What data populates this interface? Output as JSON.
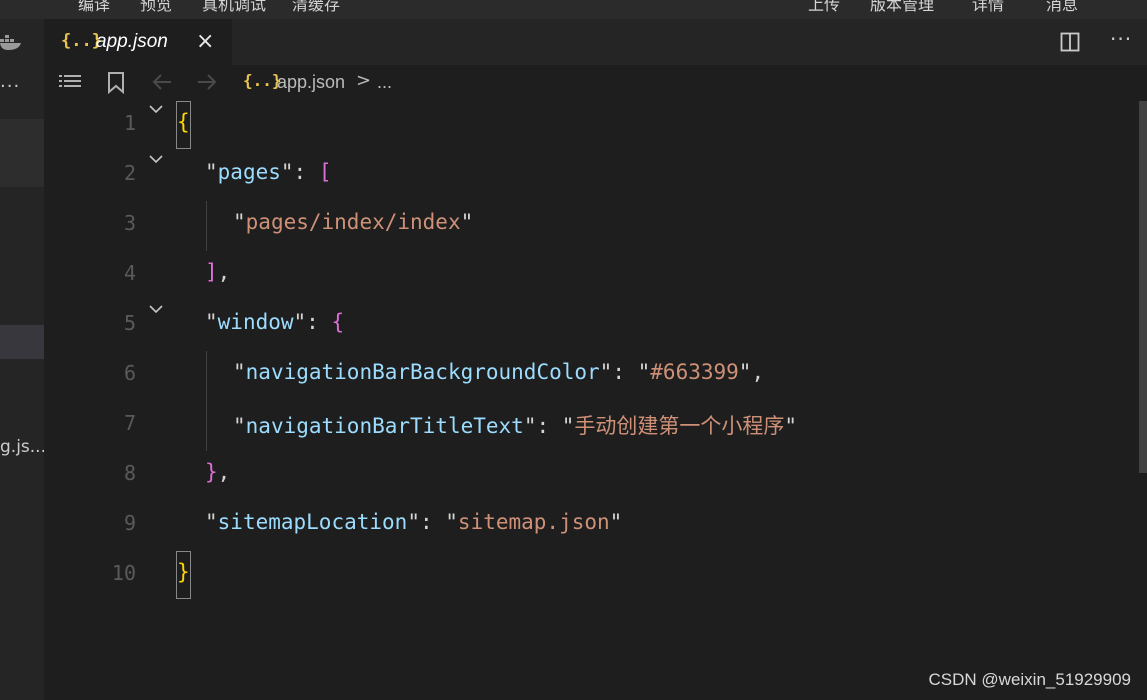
{
  "menubar": {
    "left_items": [
      "编译",
      "预览",
      "真机调试",
      "清缓存"
    ],
    "right_items": [
      "上传",
      "版本管理",
      "详情",
      "消息"
    ]
  },
  "sidebar": {
    "overflow_label": "...",
    "file_fragment": "g.js..."
  },
  "tab": {
    "icon_text": "{..}",
    "label": "app.json",
    "close_glyph": "×"
  },
  "toolbar": {
    "more_label": "···"
  },
  "breadcrumb": {
    "icon_text": "{..}",
    "file": "app.json",
    "separator": ">",
    "ellipsis": "..."
  },
  "editor": {
    "line_numbers": [
      "1",
      "2",
      "3",
      "4",
      "5",
      "6",
      "7",
      "8",
      "9",
      "10"
    ],
    "lines": [
      {
        "tokens": [
          {
            "t": "{",
            "c": "b1"
          }
        ]
      },
      {
        "tokens": [
          {
            "t": "\"",
            "c": "q"
          },
          {
            "t": "pages",
            "c": "k"
          },
          {
            "t": "\"",
            "c": "q"
          },
          {
            "t": ": ",
            "c": "p"
          },
          {
            "t": "[",
            "c": "b2"
          }
        ]
      },
      {
        "tokens": [
          {
            "t": "\"",
            "c": "q"
          },
          {
            "t": "pages/index/index",
            "c": "s"
          },
          {
            "t": "\"",
            "c": "q"
          }
        ]
      },
      {
        "tokens": [
          {
            "t": "]",
            "c": "b2"
          },
          {
            "t": ",",
            "c": "p"
          }
        ]
      },
      {
        "tokens": [
          {
            "t": "\"",
            "c": "q"
          },
          {
            "t": "window",
            "c": "k"
          },
          {
            "t": "\"",
            "c": "q"
          },
          {
            "t": ": ",
            "c": "p"
          },
          {
            "t": "{",
            "c": "b2"
          }
        ]
      },
      {
        "tokens": [
          {
            "t": "\"",
            "c": "q"
          },
          {
            "t": "navigationBarBackgroundColor",
            "c": "k"
          },
          {
            "t": "\"",
            "c": "q"
          },
          {
            "t": ": ",
            "c": "p"
          },
          {
            "t": "\"",
            "c": "q"
          },
          {
            "t": "#663399",
            "c": "s"
          },
          {
            "t": "\"",
            "c": "q"
          },
          {
            "t": ",",
            "c": "p"
          }
        ]
      },
      {
        "tokens": [
          {
            "t": "\"",
            "c": "q"
          },
          {
            "t": "navigationBarTitleText",
            "c": "k"
          },
          {
            "t": "\"",
            "c": "q"
          },
          {
            "t": ": ",
            "c": "p"
          },
          {
            "t": "\"",
            "c": "q"
          },
          {
            "t": "手动创建第一个小程序",
            "c": "s"
          },
          {
            "t": "\"",
            "c": "q"
          }
        ]
      },
      {
        "tokens": [
          {
            "t": "}",
            "c": "b2"
          },
          {
            "t": ",",
            "c": "p"
          }
        ]
      },
      {
        "tokens": [
          {
            "t": "\"",
            "c": "q"
          },
          {
            "t": "sitemapLocation",
            "c": "k"
          },
          {
            "t": "\"",
            "c": "q"
          },
          {
            "t": ": ",
            "c": "p"
          },
          {
            "t": "\"",
            "c": "q"
          },
          {
            "t": "sitemap.json",
            "c": "s"
          },
          {
            "t": "\"",
            "c": "q"
          }
        ]
      },
      {
        "tokens": [
          {
            "t": "}",
            "c": "b1"
          }
        ]
      }
    ]
  },
  "watermark": "CSDN @weixin_51929909",
  "colors": {
    "background": "#1e1e1e",
    "key": "#9cdcfe",
    "string": "#ce9178",
    "bracket_outer": "#ffd700",
    "bracket_inner": "#da70d6",
    "json_icon": "#e8c34d"
  }
}
